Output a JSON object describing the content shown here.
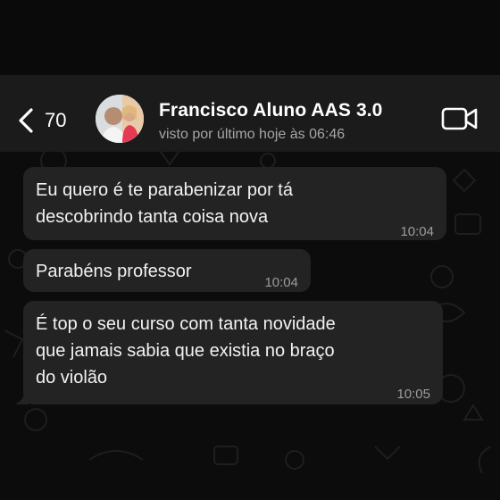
{
  "header": {
    "back_count": "70",
    "contact_name": "Francisco Aluno AAS 3.0",
    "last_seen": "visto por último hoje às 06:46",
    "back_icon": "chevron-left-icon",
    "video_icon": "video-camera-icon"
  },
  "messages": [
    {
      "lines": [
        "Eu quero é te parabenizar por tá",
        "descobrindo tanta coisa nova"
      ],
      "time": "10:04"
    },
    {
      "lines": [
        "Parabéns professor"
      ],
      "time": "10:04"
    },
    {
      "lines": [
        "É top o seu curso com tanta novidade",
        "que jamais sabia que existia no braço",
        "do violão"
      ],
      "time": "10:05"
    }
  ],
  "colors": {
    "header_bg": "#1b1b1b",
    "chat_bg": "#0c0c0c",
    "bubble_bg": "#232323",
    "timestamp": "#9c9c9c"
  }
}
